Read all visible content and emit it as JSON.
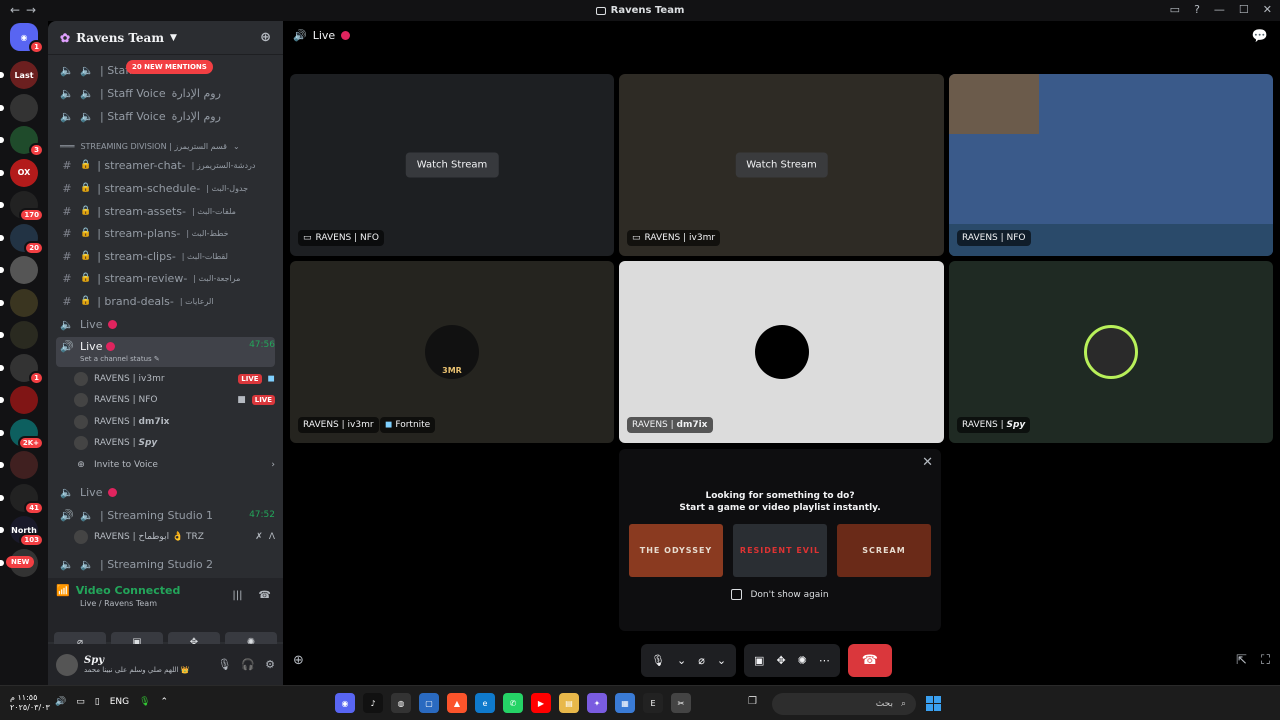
{
  "window": {
    "title": "Ravens Team"
  },
  "guilds": {
    "home_badge": "1",
    "items": [
      {
        "label": "Last",
        "badge": "",
        "bg": "#6b1f1f"
      },
      {
        "label": "",
        "badge": "",
        "bg": "#333"
      },
      {
        "label": "",
        "badge": "3",
        "bg": "#1f4b2b"
      },
      {
        "label": "OX",
        "badge": "",
        "bg": "#b31b1b"
      },
      {
        "label": "",
        "badge": "170",
        "bg": "#222"
      },
      {
        "label": "",
        "badge": "20",
        "bg": "#234"
      },
      {
        "label": "",
        "badge": "",
        "bg": "#555"
      },
      {
        "label": "",
        "badge": "",
        "bg": "#3a3520"
      },
      {
        "label": "",
        "badge": "",
        "bg": "#2a2a20"
      },
      {
        "label": "",
        "badge": "1",
        "bg": "#333"
      },
      {
        "label": "",
        "badge": "",
        "bg": "#801515"
      },
      {
        "label": "",
        "badge": "2K+",
        "bg": "#0d5f5f"
      },
      {
        "label": "",
        "badge": "",
        "bg": "#402020"
      },
      {
        "label": "",
        "badge": "41",
        "bg": "#222"
      },
      {
        "label": "North",
        "badge": "103",
        "bg": "#1a1a2a"
      },
      {
        "label": "",
        "badge": "",
        "bg": "#333"
      }
    ],
    "new_label": "NEW"
  },
  "sidebar": {
    "server_name": "Ravens Team",
    "mentions_pill": "20 NEW MENTIONS",
    "voice_top": [
      {
        "name": "| Staff",
        "arabic": ""
      },
      {
        "name": "| Staff Voice",
        "arabic": "روم الإدارة"
      },
      {
        "name": "| Staff Voice",
        "arabic": "روم الإدارة"
      }
    ],
    "category": "STREAMING DIVISION | قسم الستريمرز",
    "text_channels": [
      {
        "name": "| streamer-chat-",
        "arabic": "| دردشة-الستريمرز"
      },
      {
        "name": "| stream-schedule-",
        "arabic": "| جدول-البث"
      },
      {
        "name": "| stream-assets-",
        "arabic": "| ملفات-البث"
      },
      {
        "name": "| stream-plans-",
        "arabic": "| خطط-البث"
      },
      {
        "name": "| stream-clips-",
        "arabic": "| لقطات-البث"
      },
      {
        "name": "| stream-review-",
        "arabic": "| مراجعة-البث"
      },
      {
        "name": "| brand-deals-",
        "arabic": "| الرعايات"
      }
    ],
    "live1": "Live",
    "live_active": {
      "name": "Live",
      "timer": "47:56",
      "status": "Set a channel status"
    },
    "voice_users": [
      {
        "name": "RAVENS | iv3mr",
        "tag": "LIVE"
      },
      {
        "name": "RAVENS | NFO",
        "tag": "LIVE"
      },
      {
        "name": "RAVENS | 𝗱𝗺𝟳𝗶𝘅",
        "tag": ""
      },
      {
        "name": "RAVENS | 𝙎𝙥𝙮",
        "tag": ""
      }
    ],
    "invite": "Invite to Voice",
    "live2": "Live",
    "studio1": {
      "name": "| Streaming Studio 1",
      "timer": "47:52"
    },
    "studio1_user": "RAVENS | ابوطماح 👌 TRZ",
    "studio2": "| Streaming Studio 2"
  },
  "voice_panel": {
    "status": "Video Connected",
    "sub": "Live / Ravens Team"
  },
  "user_panel": {
    "name": "Spy",
    "status": "اللهم صلي وسلم على نبينا محمد 👑"
  },
  "main": {
    "header": "Live",
    "tiles": [
      {
        "label": "RAVENS | NFO",
        "watch": "Watch Stream",
        "game": "",
        "bg": "#1d1f22"
      },
      {
        "label": "RAVENS | iv3mr",
        "watch": "Watch Stream",
        "game": "",
        "bg": "#2e2b25"
      },
      {
        "label": "RAVENS | NFO",
        "watch": "",
        "game": "",
        "bg": "#3a5a8a"
      },
      {
        "label": "RAVENS | iv3mr",
        "watch": "",
        "game": "Fortnite",
        "bg": "#25241f"
      },
      {
        "label": "RAVENS | 𝗱𝗺𝟳𝗶𝘅",
        "watch": "",
        "game": "",
        "bg": "#dcdcdc"
      },
      {
        "label": "RAVENS | 𝙎𝙥𝙮",
        "watch": "",
        "game": "",
        "bg": "#1f2a23"
      }
    ],
    "avatar_text": "3MR",
    "activity": {
      "line1": "Looking for something to do?",
      "line2": "Start a game or video playlist instantly.",
      "games": [
        "THE ODYSSEY",
        "RESIDENT EVIL",
        "SCREAM"
      ],
      "dont_show": "Don't show again"
    }
  },
  "taskbar": {
    "time": "١١:٥٥ م",
    "date": "٢٠٢٥/٠٣/٠٣",
    "lang": "ENG",
    "search": "بحث"
  }
}
